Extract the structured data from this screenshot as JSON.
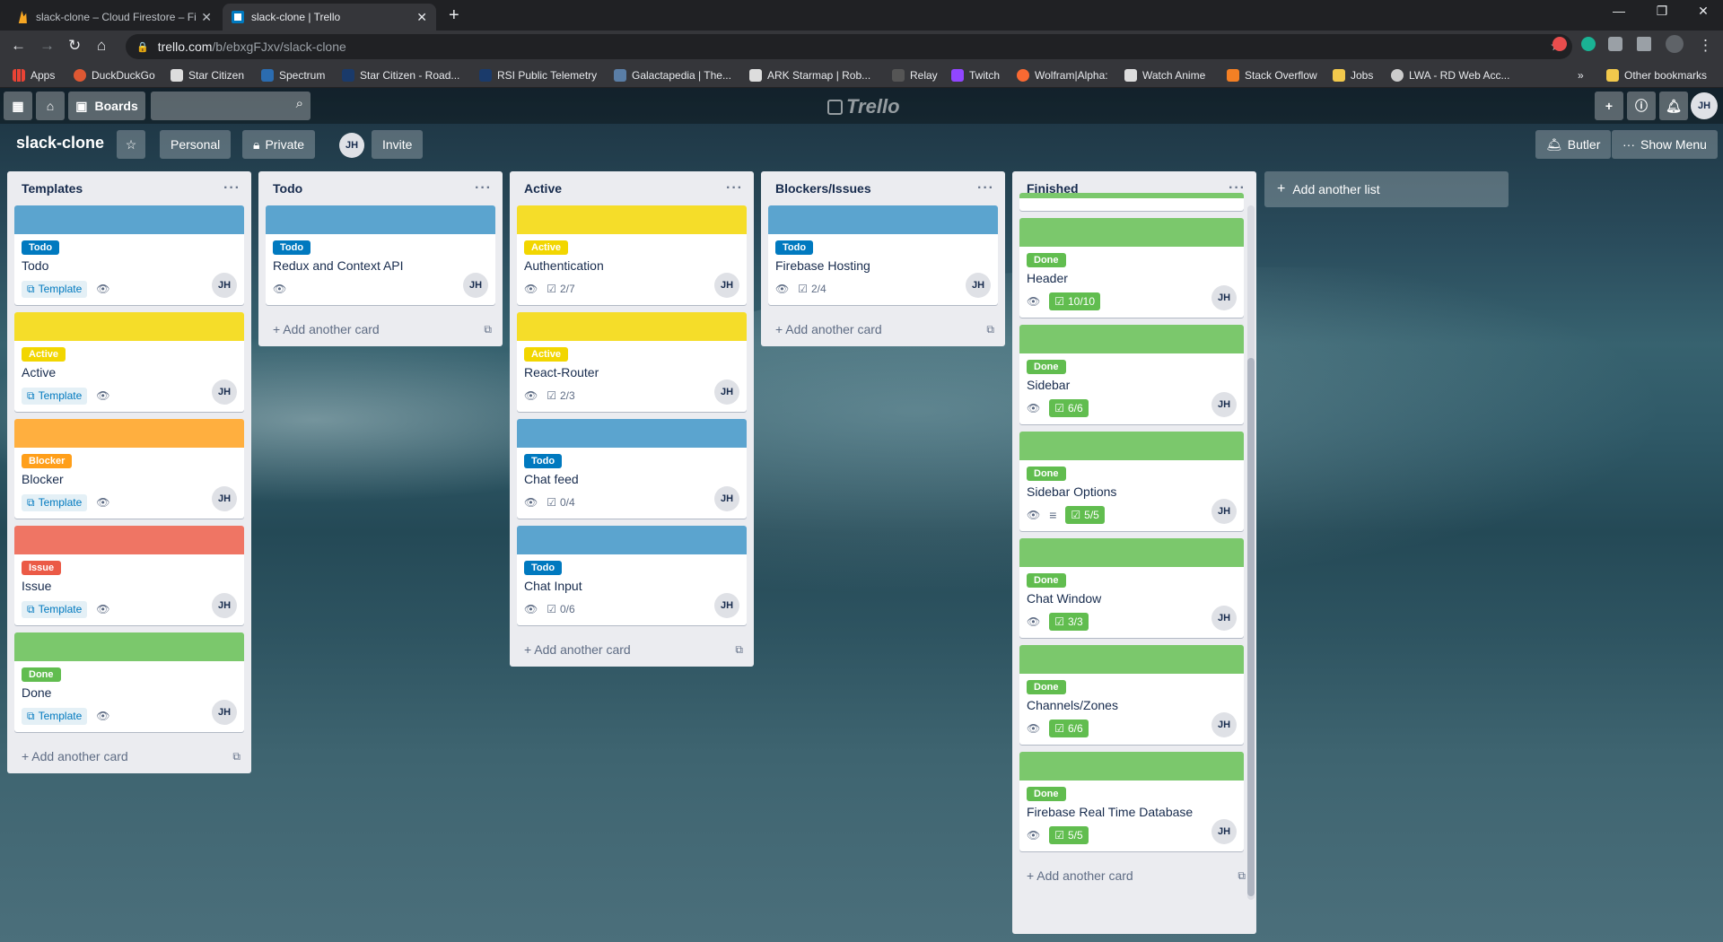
{
  "browser": {
    "tabs": [
      {
        "title": "slack-clone – Cloud Firestore – Fi",
        "icon": "firebase-icon",
        "icon_color": "#f6a623",
        "active": false
      },
      {
        "title": "slack-clone | Trello",
        "icon": "trello-icon",
        "icon_color": "#0079bf",
        "active": true
      }
    ],
    "url_host": "trello.com",
    "url_path": "/b/ebxgFJxv/slack-clone",
    "bookmarks": [
      {
        "label": "Apps",
        "color": "#ea4335"
      },
      {
        "label": "DuckDuckGo",
        "color": "#de5833"
      },
      {
        "label": "Star Citizen",
        "color": "#ffffff"
      },
      {
        "label": "Spectrum",
        "color": "#2b6cb0"
      },
      {
        "label": "Star Citizen - Road...",
        "color": "#1a3a6a"
      },
      {
        "label": "RSI Public Telemetry",
        "color": "#1a3a6a"
      },
      {
        "label": "Galactapedia | The...",
        "color": "#5a7ea6"
      },
      {
        "label": "ARK Starmap | Rob...",
        "color": "#ffffff"
      },
      {
        "label": "Relay",
        "color": "#555555"
      },
      {
        "label": "Twitch",
        "color": "#9146ff"
      },
      {
        "label": "Wolfram|Alpha:",
        "color": "#f96932"
      },
      {
        "label": "Watch Anime",
        "color": "#ffffff"
      },
      {
        "label": "Stack Overflow",
        "color": "#f48024"
      },
      {
        "label": "Jobs",
        "color": "#f2c94c"
      },
      {
        "label": "LWA - RD Web Acc...",
        "color": "#cccccc"
      }
    ],
    "bookmarks_more": "»",
    "other_bookmarks": "Other bookmarks"
  },
  "trello": {
    "boards_label": "Boards",
    "logo_text": "Trello",
    "user_initials": "JH",
    "board_title": "slack-clone",
    "personal_label": "Personal",
    "private_label": "Private",
    "invite_label": "Invite",
    "butler_label": "Butler",
    "show_menu_label": "Show Menu",
    "add_list_label": "Add another list",
    "add_card_label": "Add another card"
  },
  "colors": {
    "todo": "#0079bf",
    "todo_cover": "#5ba4cf",
    "active": "#f2d600",
    "active_cover": "#f5dd29",
    "blocker": "#ff9f1a",
    "blocker_cover": "#ffaf3f",
    "issue": "#eb5a46",
    "issue_cover": "#ef7564",
    "done": "#61bd4f",
    "done_cover": "#7bc86c"
  },
  "lists": [
    {
      "title": "Templates",
      "cards": [
        {
          "label": "Todo",
          "kind": "todo",
          "title": "Todo",
          "template": "Template"
        },
        {
          "label": "Active",
          "kind": "active",
          "title": "Active",
          "template": "Template"
        },
        {
          "label": "Blocker",
          "kind": "blocker",
          "title": "Blocker",
          "template": "Template"
        },
        {
          "label": "Issue",
          "kind": "issue",
          "title": "Issue",
          "template": "Template"
        },
        {
          "label": "Done",
          "kind": "done",
          "title": "Done",
          "template": "Template"
        }
      ]
    },
    {
      "title": "Todo",
      "cards": [
        {
          "label": "Todo",
          "kind": "todo",
          "title": "Redux and Context API"
        }
      ]
    },
    {
      "title": "Active",
      "cards": [
        {
          "label": "Active",
          "kind": "active",
          "title": "Authentication",
          "checklist": "2/7"
        },
        {
          "label": "Active",
          "kind": "active",
          "title": "React-Router",
          "checklist": "2/3"
        },
        {
          "label": "Todo",
          "kind": "todo",
          "title": "Chat feed",
          "checklist": "0/4"
        },
        {
          "label": "Todo",
          "kind": "todo",
          "title": "Chat Input",
          "checklist": "0/6"
        }
      ]
    },
    {
      "title": "Blockers/Issues",
      "cards": [
        {
          "label": "Todo",
          "kind": "todo",
          "title": "Firebase Hosting",
          "checklist": "2/4"
        }
      ]
    },
    {
      "title": "Finished",
      "cards": [
        {
          "label": "Done",
          "kind": "done",
          "title": "Header",
          "checklist": "10/10",
          "complete": true
        },
        {
          "label": "Done",
          "kind": "done",
          "title": "Sidebar",
          "checklist": "6/6",
          "complete": true
        },
        {
          "label": "Done",
          "kind": "done",
          "title": "Sidebar Options",
          "checklist": "5/5",
          "complete": true,
          "description": true
        },
        {
          "label": "Done",
          "kind": "done",
          "title": "Chat Window",
          "checklist": "3/3",
          "complete": true
        },
        {
          "label": "Done",
          "kind": "done",
          "title": "Channels/Zones",
          "checklist": "6/6",
          "complete": true
        },
        {
          "label": "Done",
          "kind": "done",
          "title": "Firebase Real Time Database",
          "checklist": "5/5",
          "complete": true
        }
      ]
    }
  ]
}
